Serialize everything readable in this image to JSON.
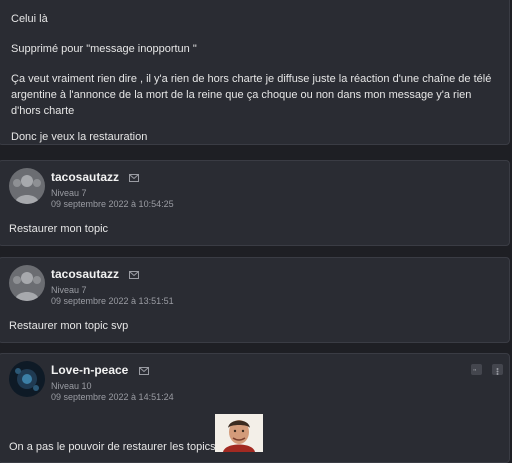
{
  "first_post": {
    "paragraphs": [
      "Celui là",
      "Supprimé pour \"message inopportun \"",
      "Ça veut vraiment rien dire , il y'a rien de hors charte je diffuse juste la réaction d'une chaîne de télé argentine à l'annonce de la mort de la reine que ça choque ou non dans mon message y'a rien d'hors charte",
      "Donc je veux la restauration"
    ]
  },
  "posts": [
    {
      "author": "tacosautazz",
      "level": "Niveau 7",
      "date": "09 septembre 2022 à 10:54:25",
      "body": "Restaurer mon topic",
      "avatar": "default-silhouette-avatar"
    },
    {
      "author": "tacosautazz",
      "level": "Niveau 7",
      "date": "09 septembre 2022 à 13:51:51",
      "body": "Restaurer mon topic svp",
      "avatar": "default-silhouette-avatar"
    },
    {
      "author": "Love-n-peace",
      "level": "Niveau 10",
      "date": "09 septembre 2022 à 14:51:24",
      "body": "On a pas le pouvoir de restaurer les topics",
      "avatar": "dark-blue-avatar",
      "inline_image": "smiling-man-sticker"
    }
  ],
  "colors": {
    "background": "#1e1f24",
    "card": "#2a2c33",
    "border": "#3a3c44",
    "muted_text": "#9a9ca3"
  }
}
